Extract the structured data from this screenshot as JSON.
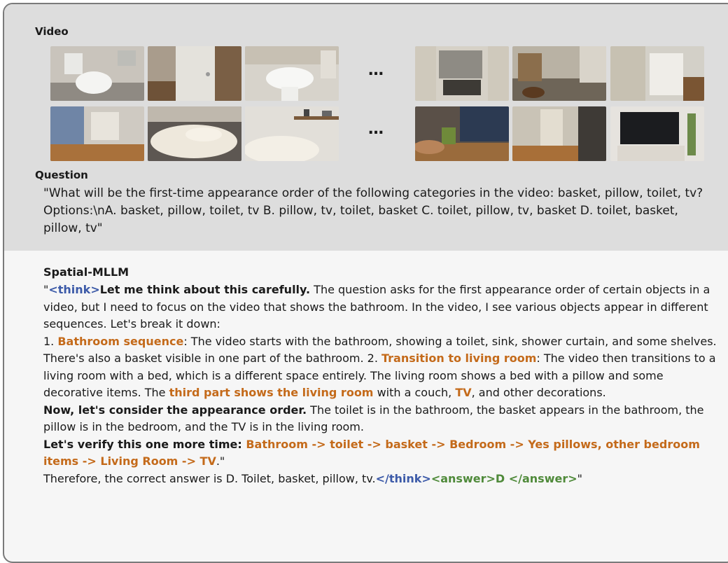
{
  "video": {
    "heading": "Video",
    "ellipsis_top": "…",
    "ellipsis_bottom": "…",
    "frames_left_top": [
      "bathroom toilet",
      "bathroom door",
      "bathroom sink"
    ],
    "frames_left_bottom": [
      "living room window",
      "bed",
      "bed with shelf"
    ],
    "frames_right_top": [
      "bathroom mirror",
      "bathroom basket",
      "bathroom corner"
    ],
    "frames_right_bottom": [
      "living room window",
      "hallway",
      "tv"
    ]
  },
  "question": {
    "heading": "Question",
    "text": "\"What will be the first-time appearance order of the following categories in the video: basket, pillow, toilet, tv? Options:\\nA. basket, pillow, toilet, tv B. pillow, tv, toilet, basket C. toilet, pillow, tv, basket D. toilet, basket, pillow, tv\""
  },
  "response": {
    "heading": "Spatial-MLLM",
    "open_quote": "\"",
    "think_open": "<think>",
    "lead": "Let me think about this carefully.",
    "p1": " The question asks for the first appearance order of certain objects in a video, but I need to focus on the video that shows the bathroom. In the video, I see various objects appear in different sequences. Let's break it down:",
    "n1": "1. ",
    "h1": "Bathroom sequence",
    "p2": ": The video starts with the bathroom, showing a toilet, sink, shower curtain, and some shelves. There's also a basket visible in one part of the bathroom. 2. ",
    "h2": "Transition to living room",
    "p3": ": The video then transitions to a living room with a bed, which is a different space entirely. The living room shows a bed with a pillow and some decorative items. The ",
    "h3": "third part shows the living room",
    "p4": " with a couch, ",
    "h4": "TV",
    "p5": ", and other decorations.",
    "now": "Now, let's consider the appearance order.",
    "p6": " The toilet is in the bathroom, the basket appears in the bathroom, the pillow is in the bedroom, and the TV is in the living room.",
    "verify": "Let's verify this one more time",
    "colon": ": ",
    "chain": "Bathroom -> toilet -> basket -> Bedroom -> Yes pillows, other bedroom items -> Living Room -> TV",
    "chain_end": ".\"",
    "therefore": "Therefore, the correct answer is D. Toilet, basket, pillow, tv.",
    "think_close": "</think>",
    "answer_tag": "<answer>D </answer>",
    "close_quote": "\""
  },
  "colors": {
    "think": "#3c5aa8",
    "highlight": "#c46a1a",
    "answer": "#4f8a3a",
    "top_bg": "#dddddd",
    "bottom_bg": "#f6f6f6"
  }
}
